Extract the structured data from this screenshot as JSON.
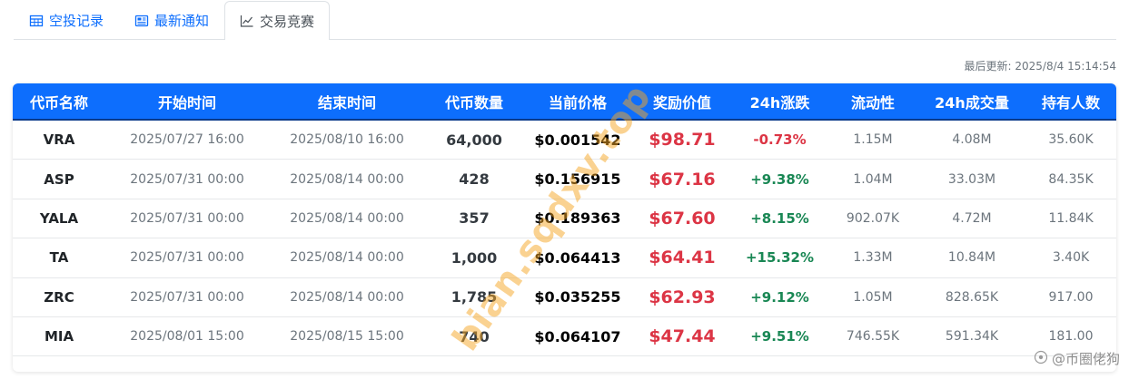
{
  "tabs": [
    {
      "label": "空投记录",
      "icon": "table-icon",
      "active": false
    },
    {
      "label": "最新通知",
      "icon": "news-icon",
      "active": false
    },
    {
      "label": "交易竞赛",
      "icon": "chart-line-icon",
      "active": true
    }
  ],
  "updated": "最后更新: 2025/8/4 15:14:54",
  "columns": [
    "代币名称",
    "开始时间",
    "结束时间",
    "代币数量",
    "当前价格",
    "奖励价值",
    "24h涨跌",
    "流动性",
    "24h成交量",
    "持有人数"
  ],
  "rows": [
    {
      "symbol": "VRA",
      "start": "2025/07/27 16:00",
      "end": "2025/08/10 16:00",
      "quantity": "64,000",
      "price": "$0.001542",
      "reward": "$98.71",
      "change": "-0.73%",
      "liquidity": "1.15M",
      "volume": "4.08M",
      "holders": "35.60K"
    },
    {
      "symbol": "ASP",
      "start": "2025/07/31 00:00",
      "end": "2025/08/14 00:00",
      "quantity": "428",
      "price": "$0.156915",
      "reward": "$67.16",
      "change": "+9.38%",
      "liquidity": "1.04M",
      "volume": "33.03M",
      "holders": "84.35K"
    },
    {
      "symbol": "YALA",
      "start": "2025/07/31 00:00",
      "end": "2025/08/14 00:00",
      "quantity": "357",
      "price": "$0.189363",
      "reward": "$67.60",
      "change": "+8.15%",
      "liquidity": "902.07K",
      "volume": "4.72M",
      "holders": "11.84K"
    },
    {
      "symbol": "TA",
      "start": "2025/07/31 00:00",
      "end": "2025/08/14 00:00",
      "quantity": "1,000",
      "price": "$0.064413",
      "reward": "$64.41",
      "change": "+15.32%",
      "liquidity": "1.33M",
      "volume": "10.84M",
      "holders": "3.40K"
    },
    {
      "symbol": "ZRC",
      "start": "2025/07/31 00:00",
      "end": "2025/08/14 00:00",
      "quantity": "1,785",
      "price": "$0.035255",
      "reward": "$62.93",
      "change": "+9.12%",
      "liquidity": "1.05M",
      "volume": "828.65K",
      "holders": "917.00"
    },
    {
      "symbol": "MIA",
      "start": "2025/08/01 15:00",
      "end": "2025/08/15 15:00",
      "quantity": "740",
      "price": "$0.064107",
      "reward": "$47.44",
      "change": "+9.51%",
      "liquidity": "746.55K",
      "volume": "591.34K",
      "holders": "181.00"
    }
  ],
  "watermark": "bian.sqdxv.top",
  "author": "@币圈佬狗",
  "colors": {
    "header": "#0d6efd",
    "up": "#198754",
    "down": "#dc3545",
    "watermark": "#f5a623"
  }
}
